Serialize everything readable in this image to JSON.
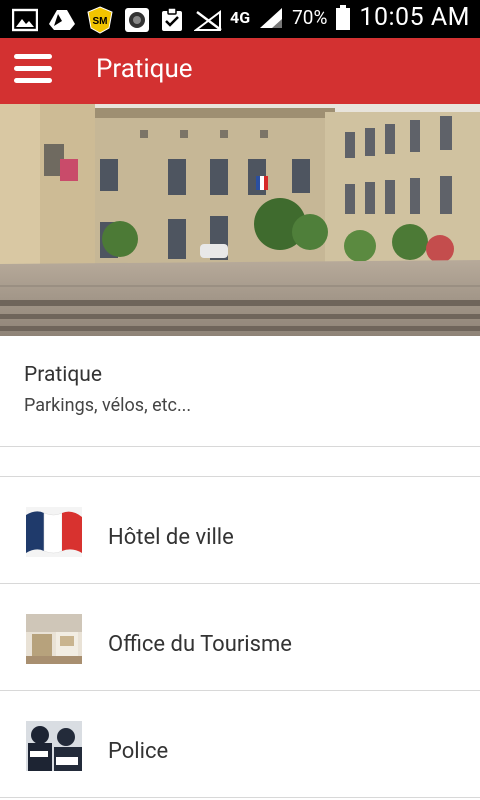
{
  "status_bar": {
    "network": "4G",
    "battery": "70%",
    "time": "10:05 AM",
    "icons": [
      "image-icon",
      "drive-icon",
      "sm-badge-icon",
      "camera-icon",
      "clipboard-check-icon",
      "no-signal-icon",
      "signal-icon",
      "battery-icon"
    ]
  },
  "app_bar": {
    "title": "Pratique",
    "menu_icon": "hamburger-menu-icon"
  },
  "intro": {
    "title": "Pratique",
    "subtitle": "Parkings, vélos, etc..."
  },
  "items": [
    {
      "label": "Hôtel de ville"
    },
    {
      "label": "Office du Tourisme"
    },
    {
      "label": "Police"
    }
  ],
  "colors": {
    "accent": "#d33131",
    "status_bar": "#000000"
  }
}
